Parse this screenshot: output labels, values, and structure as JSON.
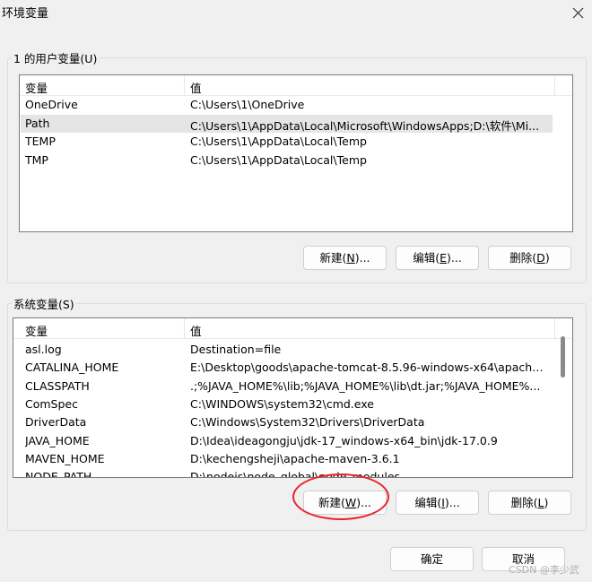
{
  "window": {
    "title": "环境变量"
  },
  "user_vars": {
    "group_label": "1 的用户变量(U)",
    "columns": {
      "name": "变量",
      "value": "值"
    },
    "rows": [
      {
        "name": "OneDrive",
        "value": "C:\\Users\\1\\OneDrive",
        "selected": false
      },
      {
        "name": "Path",
        "value": "C:\\Users\\1\\AppData\\Local\\Microsoft\\WindowsApps;D:\\软件\\Mi...",
        "selected": true
      },
      {
        "name": "TEMP",
        "value": "C:\\Users\\1\\AppData\\Local\\Temp",
        "selected": false
      },
      {
        "name": "TMP",
        "value": "C:\\Users\\1\\AppData\\Local\\Temp",
        "selected": false
      }
    ],
    "buttons": {
      "new": {
        "text": "新建(",
        "key": "N",
        "tail": ")..."
      },
      "edit": {
        "text": "编辑(",
        "key": "E",
        "tail": ")..."
      },
      "delete": {
        "text": "删除(",
        "key": "D",
        "tail": ")"
      }
    }
  },
  "system_vars": {
    "group_label": "系统变量(S)",
    "columns": {
      "name": "变量",
      "value": "值"
    },
    "rows": [
      {
        "name": "asl.log",
        "value": "Destination=file"
      },
      {
        "name": "CATALINA_HOME",
        "value": "E:\\Desktop\\goods\\apache-tomcat-8.5.96-windows-x64\\apache..."
      },
      {
        "name": "CLASSPATH",
        "value": ".;%JAVA_HOME%\\lib;%JAVA_HOME%\\lib\\dt.jar;%JAVA_HOME%..."
      },
      {
        "name": "ComSpec",
        "value": "C:\\WINDOWS\\system32\\cmd.exe"
      },
      {
        "name": "DriverData",
        "value": "C:\\Windows\\System32\\Drivers\\DriverData"
      },
      {
        "name": "JAVA_HOME",
        "value": "D:\\Idea\\ideagongju\\jdk-17_windows-x64_bin\\jdk-17.0.9"
      },
      {
        "name": "MAVEN_HOME",
        "value": "D:\\kechengsheji\\apache-maven-3.6.1"
      },
      {
        "name": "NODE_PATH",
        "value": "D:\\nodejs\\node_global\\node_modules"
      }
    ],
    "buttons": {
      "new": {
        "text": "新建(",
        "key": "W",
        "tail": ")..."
      },
      "edit": {
        "text": "编辑(",
        "key": "I",
        "tail": ")..."
      },
      "delete": {
        "text": "删除(",
        "key": "L",
        "tail": ")"
      }
    }
  },
  "dialog_buttons": {
    "ok": "确定",
    "cancel": "取消"
  },
  "watermark": "CSDN @李少武",
  "colors": {
    "highlight": "#e8252c",
    "selected_row": "#e5e5e5"
  }
}
